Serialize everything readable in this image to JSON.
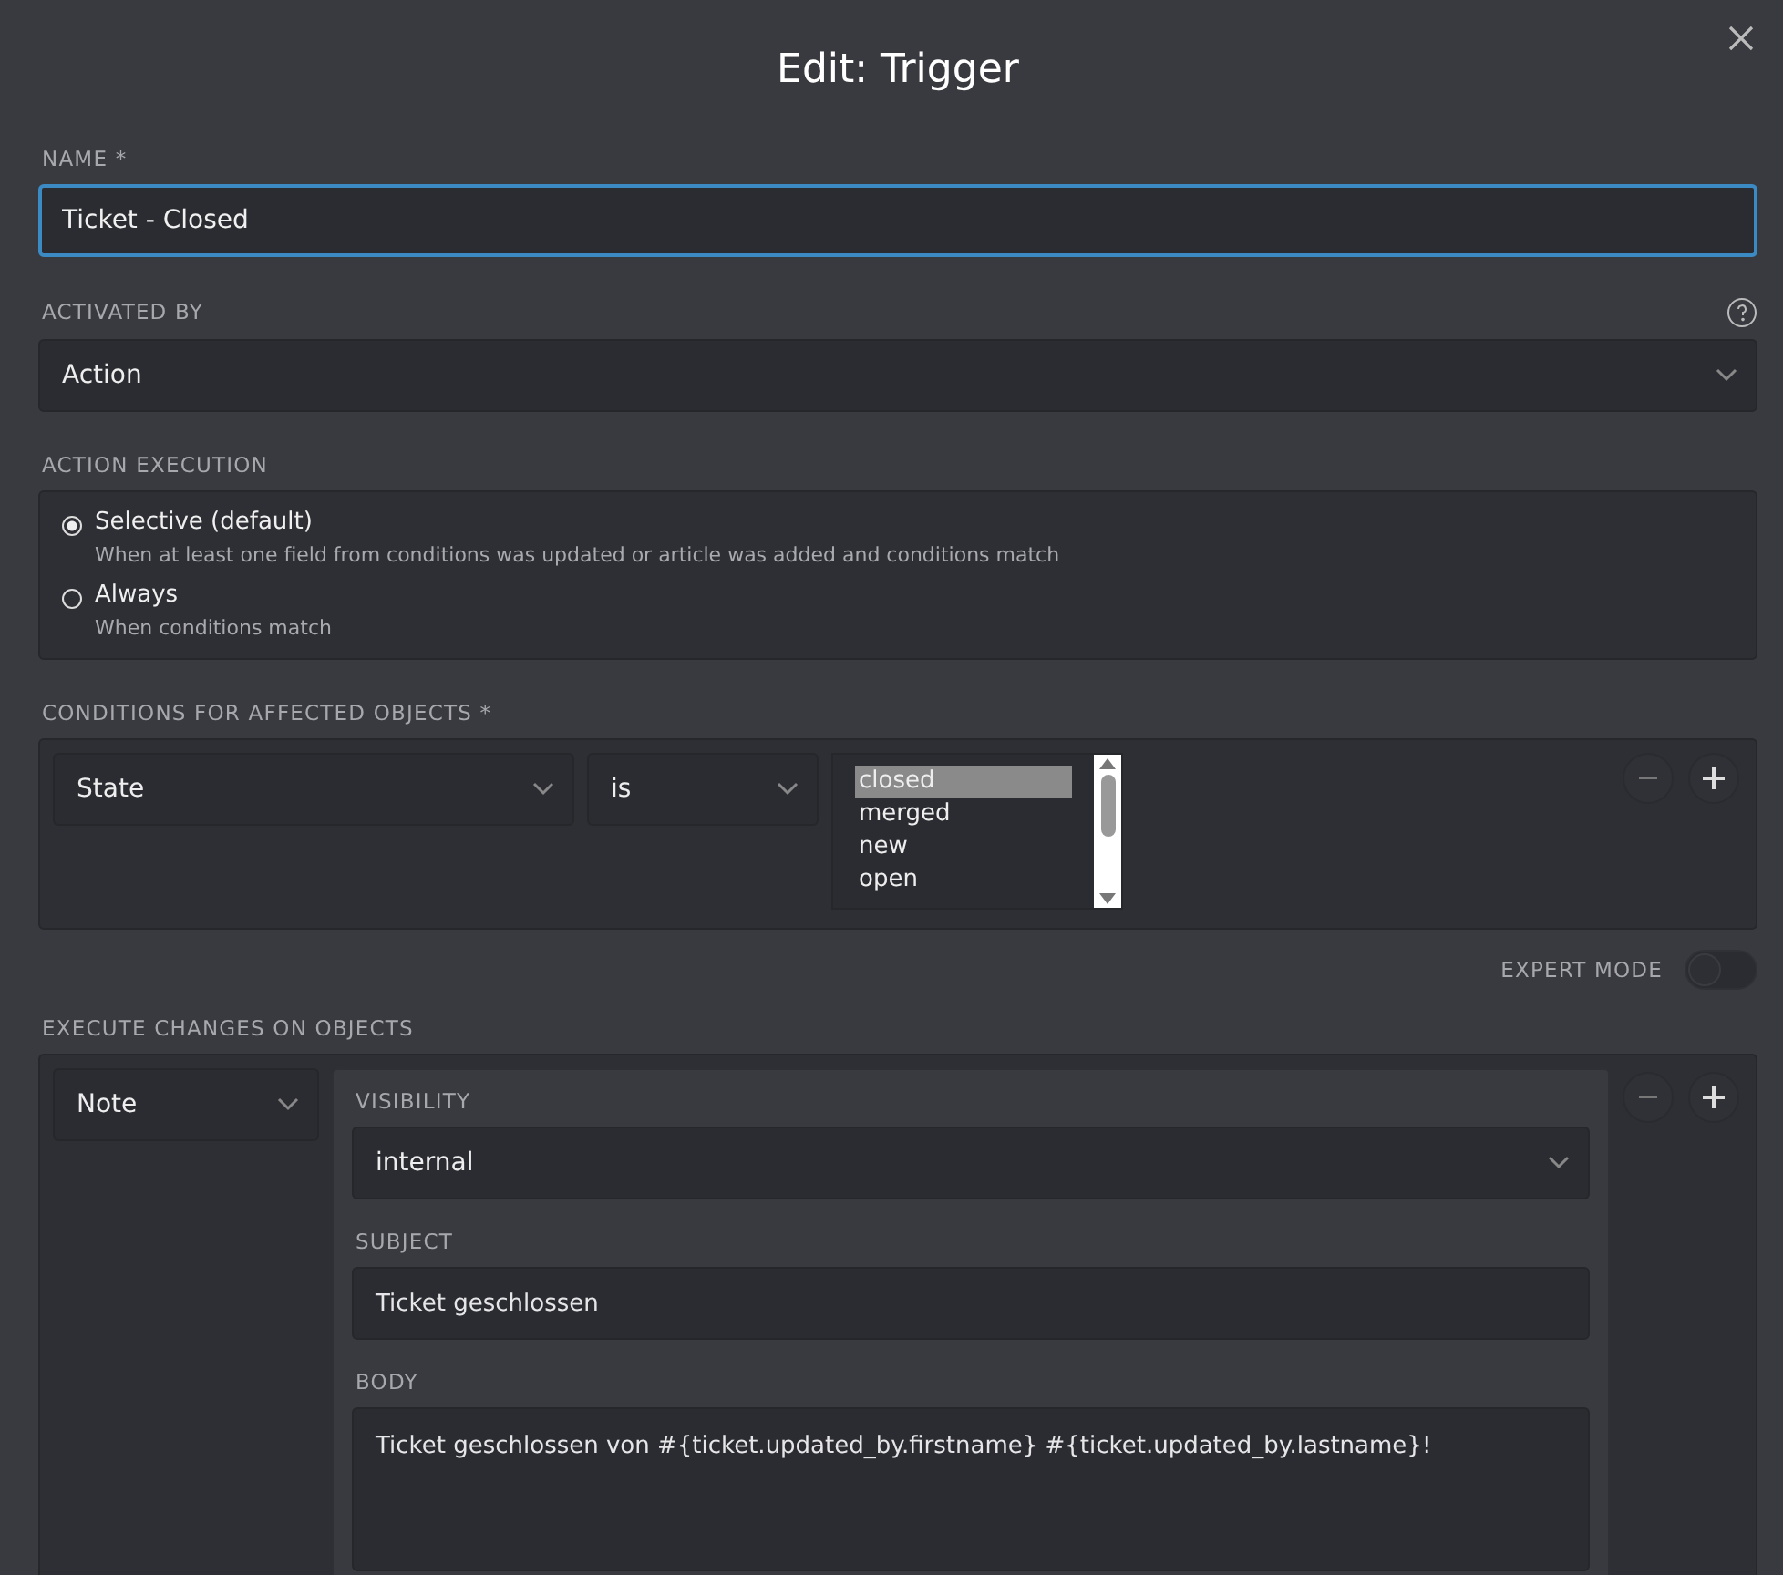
{
  "dialog": {
    "title": "Edit: Trigger"
  },
  "name_field": {
    "label": "NAME *",
    "value": "Ticket - Closed"
  },
  "activated_by": {
    "label": "ACTIVATED BY",
    "value": "Action"
  },
  "action_execution": {
    "label": "ACTION EXECUTION",
    "options": [
      {
        "label": "Selective (default)",
        "description": "When at least one field from conditions was updated or article was added and conditions match",
        "selected": true
      },
      {
        "label": "Always",
        "description": "When conditions match",
        "selected": false
      }
    ]
  },
  "conditions": {
    "label": "CONDITIONS FOR AFFECTED OBJECTS *",
    "attribute": "State",
    "operator": "is",
    "values": [
      {
        "label": "closed",
        "selected": true
      },
      {
        "label": "merged",
        "selected": false
      },
      {
        "label": "new",
        "selected": false
      },
      {
        "label": "open",
        "selected": false
      }
    ]
  },
  "expert_mode": {
    "label": "EXPERT MODE",
    "on": false
  },
  "execute": {
    "label": "EXECUTE CHANGES ON OBJECTS",
    "action": "Note",
    "fields": [
      {
        "kind": "select",
        "label": "VISIBILITY",
        "value": "internal"
      },
      {
        "kind": "input",
        "label": "SUBJECT",
        "value": "Ticket geschlossen"
      },
      {
        "kind": "textarea",
        "label": "BODY",
        "value": "Ticket geschlossen von #{ticket.updated_by.firstname} #{ticket.updated_by.lastname}!"
      }
    ]
  }
}
